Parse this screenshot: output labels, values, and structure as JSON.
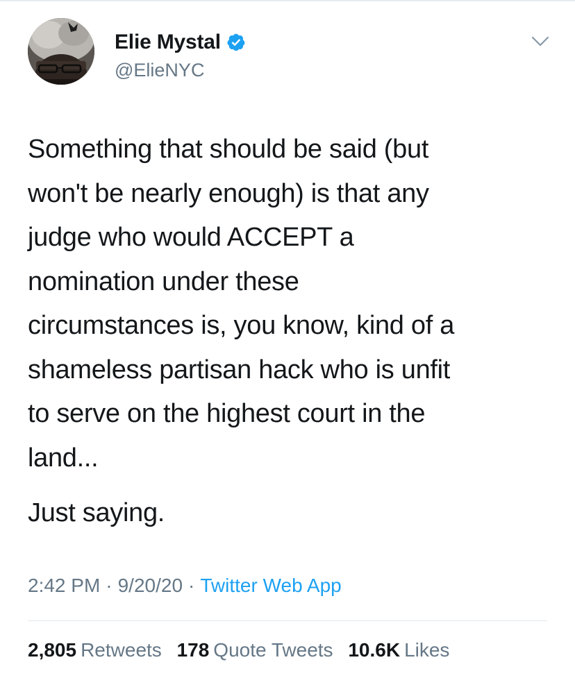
{
  "author": {
    "display_name": "Elie Mystal",
    "handle": "@ElieNYC",
    "verified_icon": "verified-check-icon",
    "colors": {
      "verified": "#1da1f2"
    }
  },
  "tweet": {
    "lines": [
      "Something that should be said (but",
      "won't be nearly enough) is that any",
      "judge who would ACCEPT a",
      "nomination under these",
      "circumstances is, you know, kind of a",
      "shameless partisan hack who is unfit",
      "to serve on the highest court in the",
      "land...",
      "Just saying."
    ]
  },
  "meta": {
    "time": "2:42 PM",
    "date": "9/20/20",
    "separator": "·",
    "source": "Twitter Web App"
  },
  "stats": {
    "retweets": {
      "count": "2,805",
      "label": "Retweets"
    },
    "quotes": {
      "count": "178",
      "label": "Quote Tweets"
    },
    "likes": {
      "count": "10.6K",
      "label": "Likes"
    }
  },
  "colors": {
    "text": "#14171a",
    "secondary": "#657786",
    "link": "#1da1f2",
    "divider": "#e1e8ed"
  }
}
